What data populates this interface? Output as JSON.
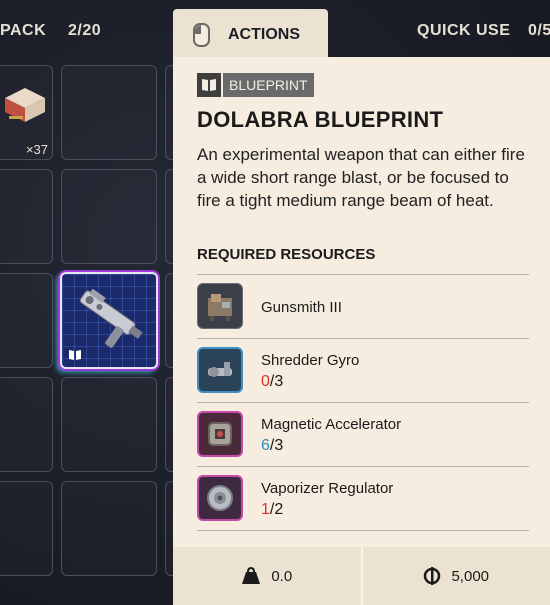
{
  "header": {
    "left_label": "PACK",
    "left_count": "2/20",
    "actions_label": "ACTIONS",
    "quick_use_label": "QUICK USE",
    "quick_use_count": "0/5"
  },
  "inventory": {
    "first_item_qty": "×37"
  },
  "tooltip": {
    "category": "BLUEPRINT",
    "title": "DOLABRA BLUEPRINT",
    "description": "An experimental weapon that can either fire a wide short range blast, or be focused to fire a tight medium range beam of heat.",
    "required_title": "REQUIRED RESOURCES",
    "resources": [
      {
        "name": "Gunsmith III",
        "have": "",
        "sep": "",
        "need": "",
        "icon": "workbench-icon"
      },
      {
        "name": "Shredder Gyro",
        "have": "0",
        "sep": "/",
        "need": "3",
        "have_color": "#e0302a",
        "icon": "gyro-icon"
      },
      {
        "name": "Magnetic Accelerator",
        "have": "6",
        "sep": "/",
        "need": "3",
        "have_color": "#2f8fb8",
        "icon": "accelerator-icon"
      },
      {
        "name": "Vaporizer Regulator",
        "have": "1",
        "sep": "/",
        "need": "2",
        "have_color": "#e0302a",
        "icon": "regulator-icon"
      }
    ],
    "weight": "0.0",
    "value": "5,000"
  },
  "colors": {
    "panel_bg": "#f6ecdf",
    "missing": "#e0302a",
    "sufficient": "#2f8fb8",
    "rare_border": "#c64aa8",
    "uncommon_border": "#3f8fc6"
  }
}
